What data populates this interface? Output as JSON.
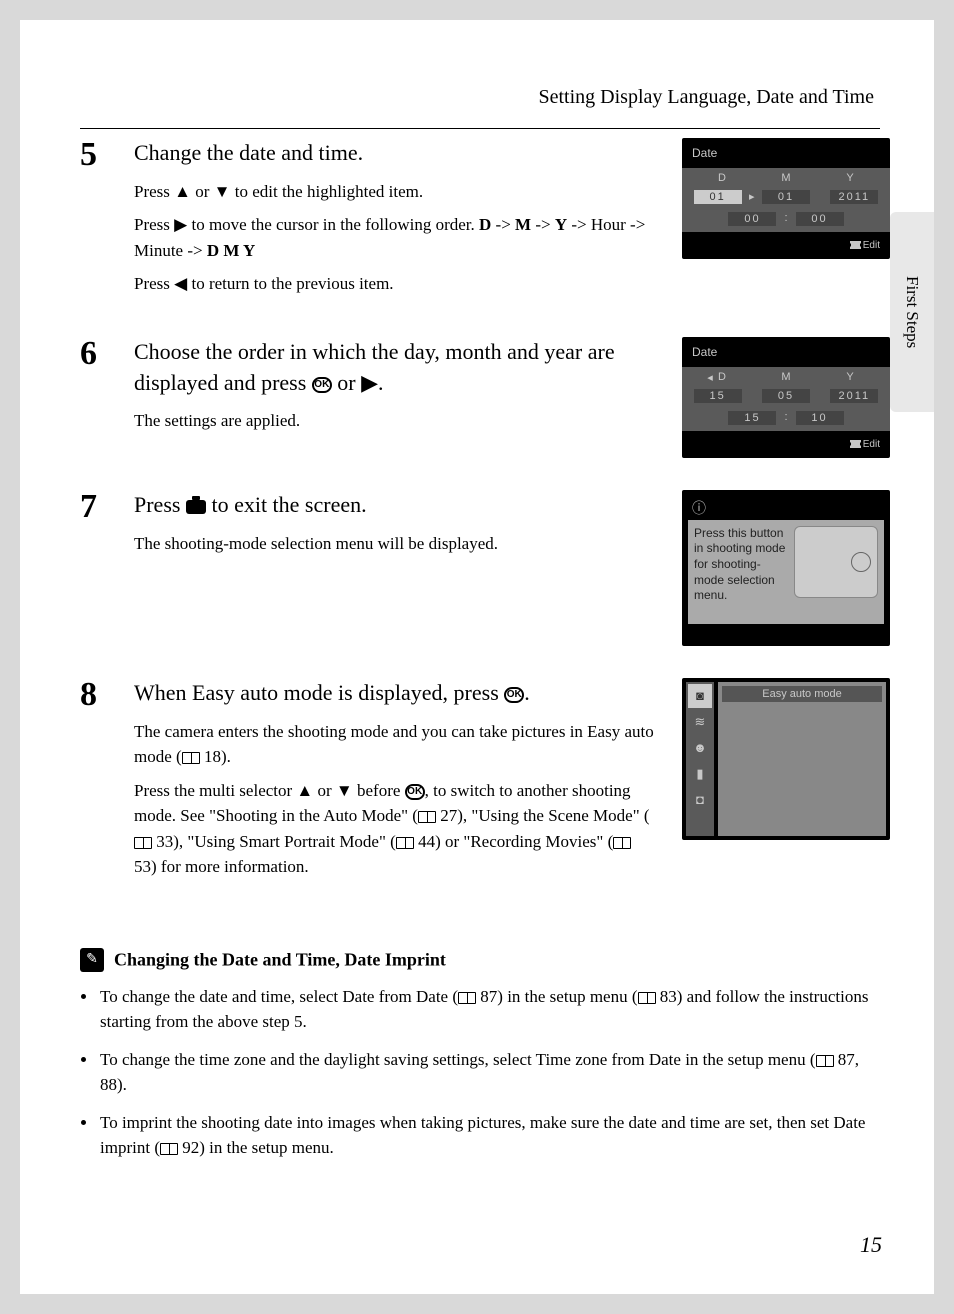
{
  "header": {
    "title": "Setting Display Language, Date and Time"
  },
  "side_tab": "First Steps",
  "page_number": "15",
  "steps": {
    "s5": {
      "num": "5",
      "title": "Change the date and time.",
      "l1a": "Press ",
      "l1b": " or ",
      "l1c": " to edit the highlighted item.",
      "l2a": "Press ",
      "l2b": " to move the cursor in the following order. ",
      "l2c": "D",
      "l2d": " -> ",
      "l2e": "M",
      "l2f": " -> ",
      "l2g": "Y",
      "l2h": " -> Hour -> Minute -> ",
      "l2i": "D M Y",
      "l3a": "Press ",
      "l3b": " to return to the previous item."
    },
    "s6": {
      "num": "6",
      "t1": "Choose the order in which the day, month and year are displayed and press ",
      "t2": " or ",
      "t3": ".",
      "l1": "The settings are applied."
    },
    "s7": {
      "num": "7",
      "t1": "Press ",
      "t2": " to exit the screen.",
      "l1": "The shooting-mode selection menu will be displayed."
    },
    "s8": {
      "num": "8",
      "t1": "When Easy auto mode is displayed, press ",
      "t2": ".",
      "l1a": "The camera enters the shooting mode and you can take pictures in Easy auto mode (",
      "l1b": " 18).",
      "l2a": "Press the multi selector ",
      "l2b": " or ",
      "l2c": " before ",
      "l2d": ", to switch to another shooting mode. See \"Shooting in the Auto Mode\" (",
      "l2e": " 27), \"Using the Scene Mode\" (",
      "l2f": " 33), \"Using Smart Portrait Mode\" (",
      "l2g": " 44) or \"Recording Movies\" (",
      "l2h": " 53) for more information."
    }
  },
  "lcd1": {
    "title": "Date",
    "h": {
      "d": "D",
      "m": "M",
      "y": "Y"
    },
    "v": {
      "d": "01",
      "m": "01",
      "y": "2011",
      "hh": "00",
      "mm": "00"
    },
    "edit": "Edit"
  },
  "lcd2": {
    "title": "Date",
    "h": {
      "d": "D",
      "m": "M",
      "y": "Y"
    },
    "v": {
      "d": "15",
      "m": "05",
      "y": "2011",
      "hh": "15",
      "mm": "10"
    },
    "edit": "Edit"
  },
  "lcd3": {
    "info_icon": "ⓘ",
    "text": "Press this button in shooting mode for shooting-mode selection menu."
  },
  "lcd4": {
    "label": "Easy auto mode"
  },
  "note": {
    "title": "Changing the Date and Time, Date Imprint",
    "b1a": "To change the date and time, select ",
    "b1b": "Date",
    "b1c": " from ",
    "b1d": "Date",
    "b1e": " (",
    "b1f": " 87) in the setup menu (",
    "b1g": " 83) and follow the instructions starting from the above step 5.",
    "b2a": "To change the time zone and the daylight saving settings, select ",
    "b2b": "Time zone",
    "b2c": " from ",
    "b2d": "Date",
    "b2e": " in the setup menu (",
    "b2f": " 87, 88).",
    "b3a": "To imprint the shooting date into images when taking pictures, make sure the date and time are set, then set ",
    "b3b": "Date imprint",
    "b3c": " (",
    "b3d": " 92) in the setup menu."
  }
}
